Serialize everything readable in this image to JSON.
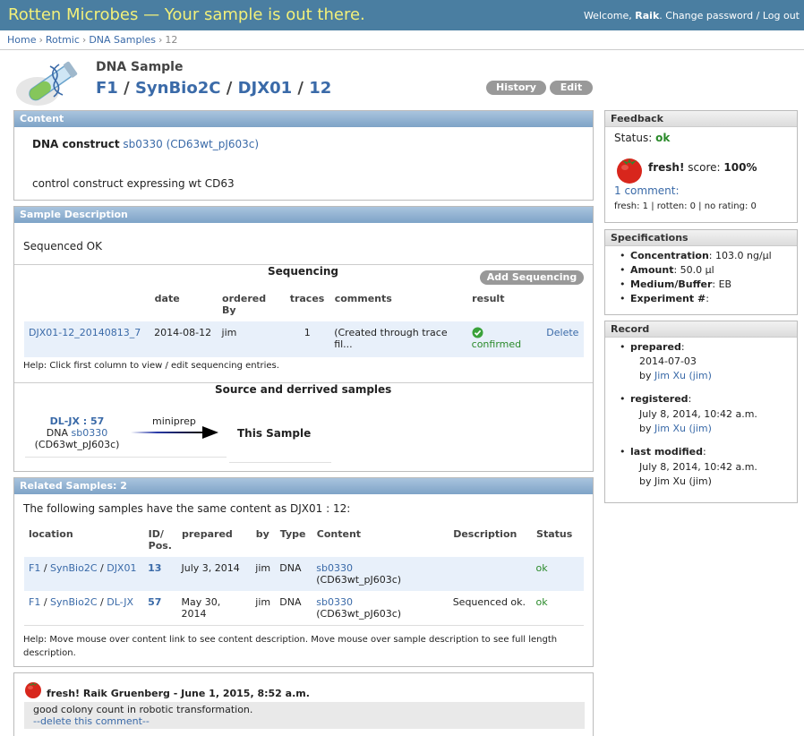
{
  "header": {
    "site_title": "Rotten Microbes — Your sample is out there.",
    "welcome": "Welcome,",
    "user_name": "Raik",
    "change_password": "Change password",
    "slash": "/",
    "logout": "Log out"
  },
  "breadcrumb": [
    "Home",
    "Rotmic",
    "DNA Samples",
    "12"
  ],
  "page": {
    "type_label": "DNA Sample",
    "title_parts": [
      "F1",
      "SynBio2C",
      "DJX01",
      "12"
    ],
    "history_button": "History",
    "edit_button": "Edit"
  },
  "content_box": {
    "heading": "Content",
    "construct_label": "DNA construct",
    "construct_link": "sb0330 (CD63wt_pJ603c)",
    "description": "control construct expressing wt CD63"
  },
  "sample_description": {
    "heading": "Sample Description",
    "text": "Sequenced OK"
  },
  "sequencing": {
    "title": "Sequencing",
    "add_button": "Add Sequencing",
    "columns": [
      "",
      "date",
      "ordered By",
      "traces",
      "comments",
      "result",
      ""
    ],
    "rows": [
      {
        "name": "DJX01-12_20140813_7",
        "date": "2014-08-12",
        "ordered_by": "jim",
        "traces": "1",
        "comments": "(Created through trace fil...",
        "result": "confirmed",
        "action": "Delete"
      }
    ],
    "help": "Help: Click first column to view / edit sequencing entries."
  },
  "source": {
    "title": "Source and derrived samples",
    "parent_id": "DL-JX : 57",
    "parent_kind": "DNA",
    "parent_link": "sb0330",
    "parent_desc": "(CD63wt_pJ603c)",
    "arrow_label": "miniprep",
    "this_sample": "This Sample"
  },
  "related": {
    "heading": "Related Samples: 2",
    "intro": "The following samples have the same content as DJX01 : 12:",
    "columns": [
      "location",
      "ID/ Pos.",
      "prepared",
      "by",
      "Type",
      "Content",
      "Description",
      "Status"
    ],
    "rows": [
      {
        "loc1": "F1",
        "loc2": "SynBio2C",
        "loc3": "DJX01",
        "id": "13",
        "prepared": "July 3, 2014",
        "by": "jim",
        "type": "DNA",
        "content_link": "sb0330",
        "content_desc": "(CD63wt_pJ603c)",
        "description": "",
        "status": "ok"
      },
      {
        "loc1": "F1",
        "loc2": "SynBio2C",
        "loc3": "DL-JX",
        "id": "57",
        "prepared": "May 30, 2014",
        "by": "jim",
        "type": "DNA",
        "content_link": "sb0330",
        "content_desc": "(CD63wt_pJ603c)",
        "description": "Sequenced ok.",
        "status": "ok"
      }
    ],
    "help": "Help: Move mouse over content link to see content description. Move mouse over sample description to see full length description."
  },
  "comment": {
    "header": "fresh! Raik Gruenberg - June 1, 2015, 8:52 a.m.",
    "body": "good colony count in robotic transformation.",
    "delete_link": "--delete this comment--"
  },
  "feedback": {
    "heading": "Feedback",
    "status_label": "Status:",
    "status_value": "ok",
    "fresh_label": "fresh!",
    "score_label": "score:",
    "score_value": "100%",
    "comments_link": "1 comment:",
    "tally": "fresh: 1 | rotten: 0 | no rating: 0"
  },
  "specifications": {
    "heading": "Specifications",
    "items": [
      {
        "label": "Concentration",
        "value": "103.0 ng/µl"
      },
      {
        "label": "Amount",
        "value": "50.0 µl"
      },
      {
        "label": "Medium/Buffer",
        "value": "EB"
      },
      {
        "label": "Experiment #",
        "value": ""
      }
    ]
  },
  "record": {
    "heading": "Record",
    "prepared_label": "prepared",
    "prepared_date": "2014-07-03",
    "prepared_by_prefix": "by",
    "prepared_by": "Jim Xu (jim)",
    "registered_label": "registered",
    "registered_date": "July 8, 2014, 10:42 a.m.",
    "registered_by_prefix": "by",
    "registered_by": "Jim Xu (jim)",
    "modified_label": "last modified",
    "modified_date": "July 8, 2014, 10:42 a.m.",
    "modified_by": "by Jim Xu (jim)",
    "colon": ":"
  },
  "colors": {
    "topbar": "#4a7ea1",
    "site_title": "#f2f07a",
    "link": "#3a6aa8",
    "ok": "#2a8a2a",
    "box_header": "#8fb0d0"
  }
}
